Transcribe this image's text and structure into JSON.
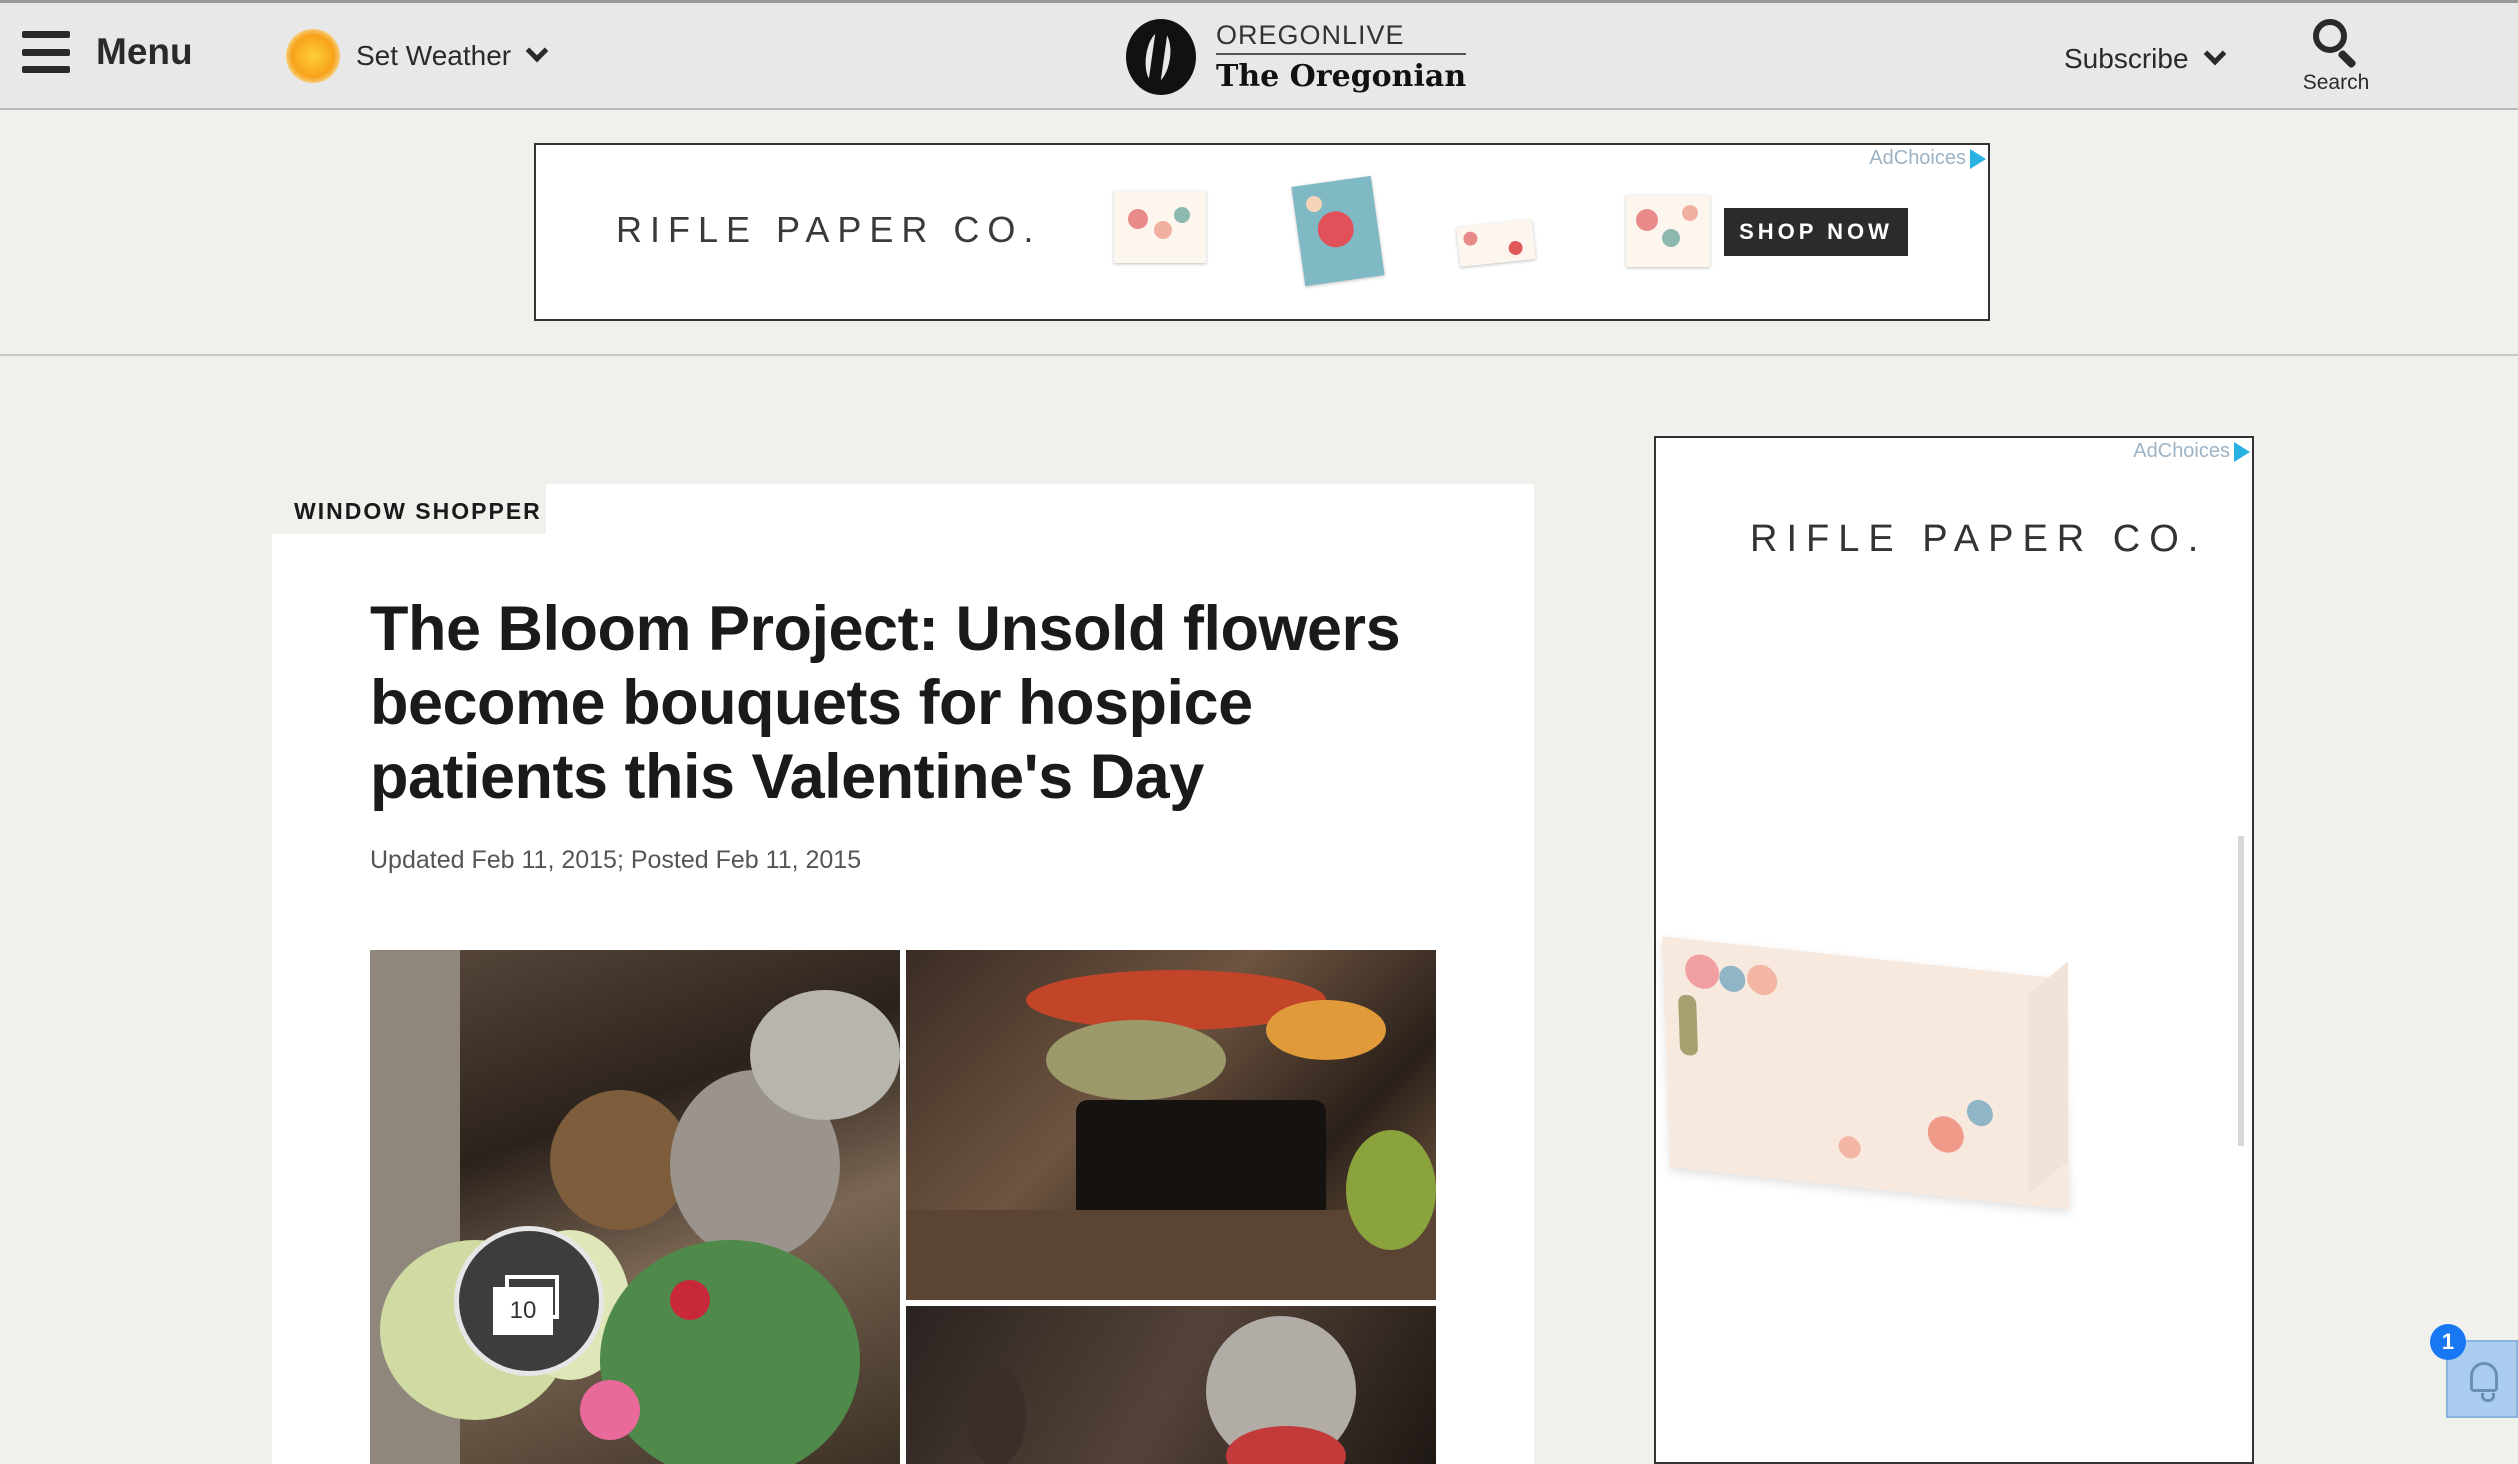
{
  "header": {
    "menu_label": "Menu",
    "weather_label": "Set Weather",
    "logo_top": "OREGONLIVE",
    "logo_bottom": "The Oregonian",
    "subscribe_label": "Subscribe",
    "search_label": "Search"
  },
  "banner_ad": {
    "adchoices": "AdChoices",
    "brand": "RIFLE PAPER CO.",
    "cta": "SHOP NOW"
  },
  "article": {
    "section": "WINDOW SHOPPER",
    "headline": "The Bloom Project: Unsold flowers become bouquets for hospice patients this Valentine's Day",
    "dateline": "Updated Feb 11, 2015; Posted Feb 11, 2015",
    "gallery_count": "10"
  },
  "side_ad": {
    "adchoices": "AdChoices",
    "brand": "RIFLE PAPER CO."
  },
  "notifications": {
    "count": "1"
  },
  "colors": {
    "page_bg": "#f0f0ec",
    "header_bg": "#e8e8e8",
    "cta_bg": "#2b2b2b",
    "badge_blue": "#1877f2"
  }
}
